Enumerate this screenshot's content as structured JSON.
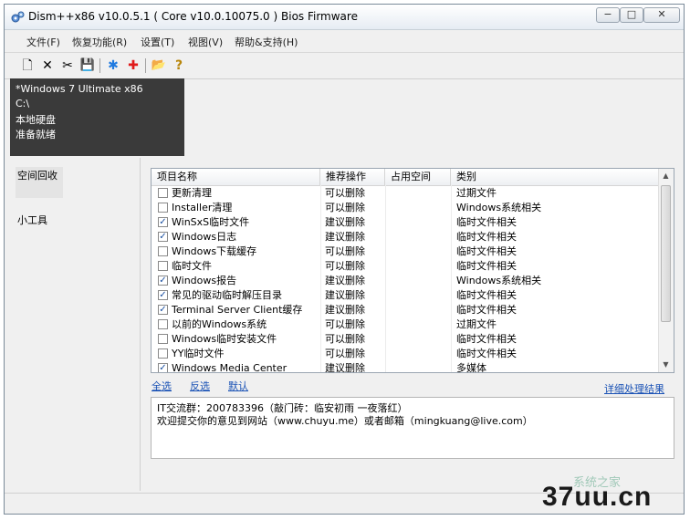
{
  "window": {
    "title": "Dism++x86 v10.0.5.1 ( Core v10.0.10075.0 ) Bios Firmware",
    "controls": [
      "−",
      "□",
      "✕"
    ]
  },
  "menu": [
    "文件(F)",
    "恢复功能(R)",
    "设置(T)",
    "视图(V)",
    "帮助&支持(H)"
  ],
  "toolbar": {
    "new": "🗋",
    "close": "✕",
    "cut": "✂",
    "save": "💾",
    "star": "✱",
    "add": "✚",
    "open": "📂",
    "help": "?"
  },
  "info": {
    "os": "*Windows 7 Ultimate x86",
    "drive": "C:\\",
    "disk": "本地硬盘",
    "status": "准备就绪"
  },
  "sidebar": [
    "空间回收",
    "小工具"
  ],
  "table": {
    "columns": [
      "项目名称",
      "推荐操作",
      "占用空间",
      "类别"
    ],
    "rows": [
      {
        "name": "更新清理",
        "action": "可以删除",
        "size": "",
        "category": "过期文件",
        "checked": false
      },
      {
        "name": "Installer清理",
        "action": "可以删除",
        "size": "",
        "category": "Windows系统相关",
        "checked": false
      },
      {
        "name": "WinSxS临时文件",
        "action": "建议删除",
        "size": "",
        "category": "临时文件相关",
        "checked": true
      },
      {
        "name": "Windows日志",
        "action": "建议删除",
        "size": "",
        "category": "临时文件相关",
        "checked": true
      },
      {
        "name": "Windows下载缓存",
        "action": "可以删除",
        "size": "",
        "category": "临时文件相关",
        "checked": false
      },
      {
        "name": "临时文件",
        "action": "可以删除",
        "size": "",
        "category": "临时文件相关",
        "checked": false
      },
      {
        "name": "Windows报告",
        "action": "建议删除",
        "size": "",
        "category": "Windows系统相关",
        "checked": true
      },
      {
        "name": "常见的驱动临时解压目录",
        "action": "建议删除",
        "size": "",
        "category": "临时文件相关",
        "checked": true
      },
      {
        "name": "Terminal Server Client缓存",
        "action": "建议删除",
        "size": "",
        "category": "临时文件相关",
        "checked": true
      },
      {
        "name": "以前的Windows系统",
        "action": "可以删除",
        "size": "",
        "category": "过期文件",
        "checked": false
      },
      {
        "name": "Windows临时安装文件",
        "action": "可以删除",
        "size": "",
        "category": "临时文件相关",
        "checked": false
      },
      {
        "name": "YY临时文件",
        "action": "可以删除",
        "size": "",
        "category": "临时文件相关",
        "checked": false
      },
      {
        "name": "Windows Media Center",
        "action": "建议删除",
        "size": "",
        "category": "多媒体",
        "checked": true
      }
    ]
  },
  "links": {
    "select_all": "全选",
    "invert": "反选",
    "default": "默认",
    "details": "详细处理结果"
  },
  "messages": {
    "line1": "IT交流群：200783396（敲门砖：临安初雨 一夜落红）",
    "line2": "欢迎提交你的意见到网站（www.chuyu.me）或者邮箱（mingkuang@live.com）"
  },
  "watermark": {
    "brand": "37uu.cn",
    "sub": "系统之家"
  }
}
